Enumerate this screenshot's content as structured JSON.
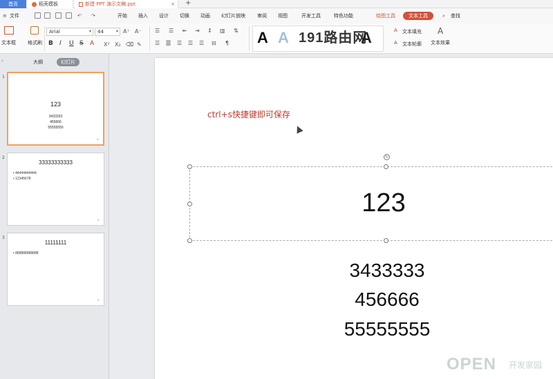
{
  "tabs": {
    "home": "首页",
    "template": "稻壳模板",
    "document": "新建 PPT 演示文稿.ppt",
    "close": "×",
    "add": "+"
  },
  "menu": {
    "file": "文件",
    "items": [
      "开始",
      "插入",
      "设计",
      "切换",
      "动画",
      "幻灯片放映",
      "审阅",
      "视图",
      "开发工具",
      "特色功能"
    ],
    "drawing_tools": "绘图工具",
    "text_tools": "文本工具",
    "search": "查找"
  },
  "ribbon": {
    "text_box": "文本框",
    "format_painter": "格式刷",
    "font_name": "Arial",
    "font_size": "44",
    "text_fill": "文本填充",
    "text_outline": "文本轮廓",
    "text_effects": "文本效果",
    "watermark": "191路由网"
  },
  "left_panel": {
    "outline_tab": "大纲",
    "slides_tab": "幻灯片",
    "slides": [
      {
        "number": "1",
        "title": "123",
        "lines": [
          "3433333",
          "456666",
          "55555555"
        ]
      },
      {
        "number": "2",
        "title": "33333333333",
        "bullets": [
          "44444444444",
          "12345678"
        ]
      },
      {
        "number": "3",
        "title": "11111111",
        "bullets": [
          "888888888888"
        ]
      }
    ]
  },
  "slide": {
    "note": "ctrl+s快捷键即可保存",
    "title": "123",
    "lines": [
      "3433333",
      "456666",
      "55555555"
    ]
  },
  "brand": {
    "main": "OPEN",
    "sub": "开发家园"
  }
}
